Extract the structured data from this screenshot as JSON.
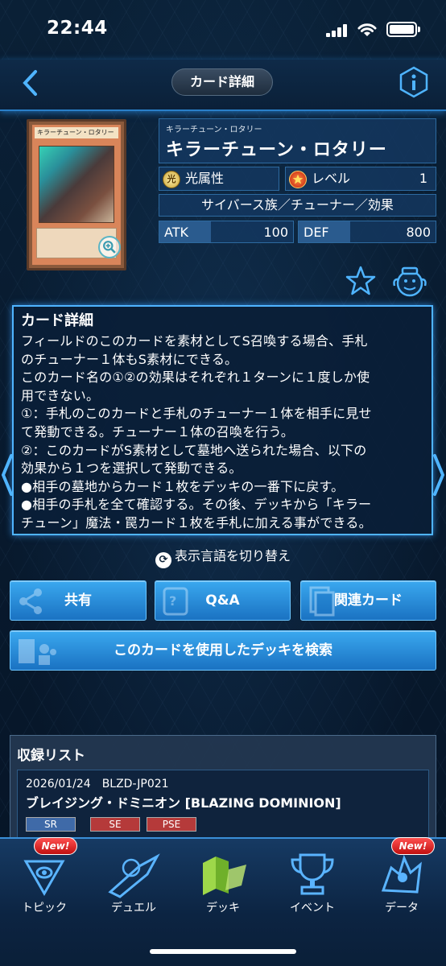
{
  "status_bar": {
    "time": "22:44"
  },
  "header": {
    "title": "カード詳細"
  },
  "card": {
    "image_name": "キラーチューン・ロタリー",
    "name_ruby": "キラーチューン・ロタリー",
    "name": "キラーチューン・ロタリー",
    "attribute_icon": "光",
    "attribute": "光属性",
    "level_label": "レベル",
    "level": "1",
    "type_line": "サイバース族／チューナー／効果",
    "atk_label": "ATK",
    "atk": "100",
    "def_label": "DEF",
    "def": "800"
  },
  "description": {
    "title": "カード詳細",
    "lines": [
      "フィールドのこのカードを素材としてS召喚する場合、手札",
      "のチューナー１体もS素材にできる。",
      "このカード名の①②の効果はそれぞれ１ターンに１度しか使",
      "用できない。",
      "①：手札のこのカードと手札のチューナー１体を相手に見せ",
      "て発動できる。チューナー１体の召喚を行う。",
      "②：このカードがS素材として墓地へ送られた場合、以下の",
      "効果から１つを選択して発動できる。",
      "●相手の墓地からカード１枚をデッキの一番下に戻す。",
      "●相手の手札を全て確認する。その後、デッキから「キラー",
      "チューン」魔法・罠カード１枚を手札に加える事ができる。"
    ]
  },
  "language_switch": {
    "icon": "⟳",
    "label": "表示言語を切り替え"
  },
  "buttons": {
    "share": "共有",
    "qa": "Q&A",
    "related": "関連カード",
    "deck_search": "このカードを使用したデッキを検索"
  },
  "release_list": {
    "title": "収録リスト",
    "items": [
      {
        "meta": "2026/01/24　BLZD-JP021",
        "name": "ブレイジング・ドミニオン [BLAZING DOMINION]",
        "rarities": [
          "SR",
          "SE",
          "PSE"
        ]
      }
    ]
  },
  "bottom_nav": {
    "badge": "New!",
    "items": [
      {
        "label": "トピック",
        "icon": "topic-icon"
      },
      {
        "label": "デュエル",
        "icon": "duel-icon"
      },
      {
        "label": "デッキ",
        "icon": "deck-icon"
      },
      {
        "label": "イベント",
        "icon": "event-icon"
      },
      {
        "label": "データ",
        "icon": "data-icon"
      }
    ]
  },
  "colors": {
    "accent": "#4fb4ff",
    "button": "#2a8de0",
    "background": "#07192c",
    "new_badge": "#e02020"
  }
}
